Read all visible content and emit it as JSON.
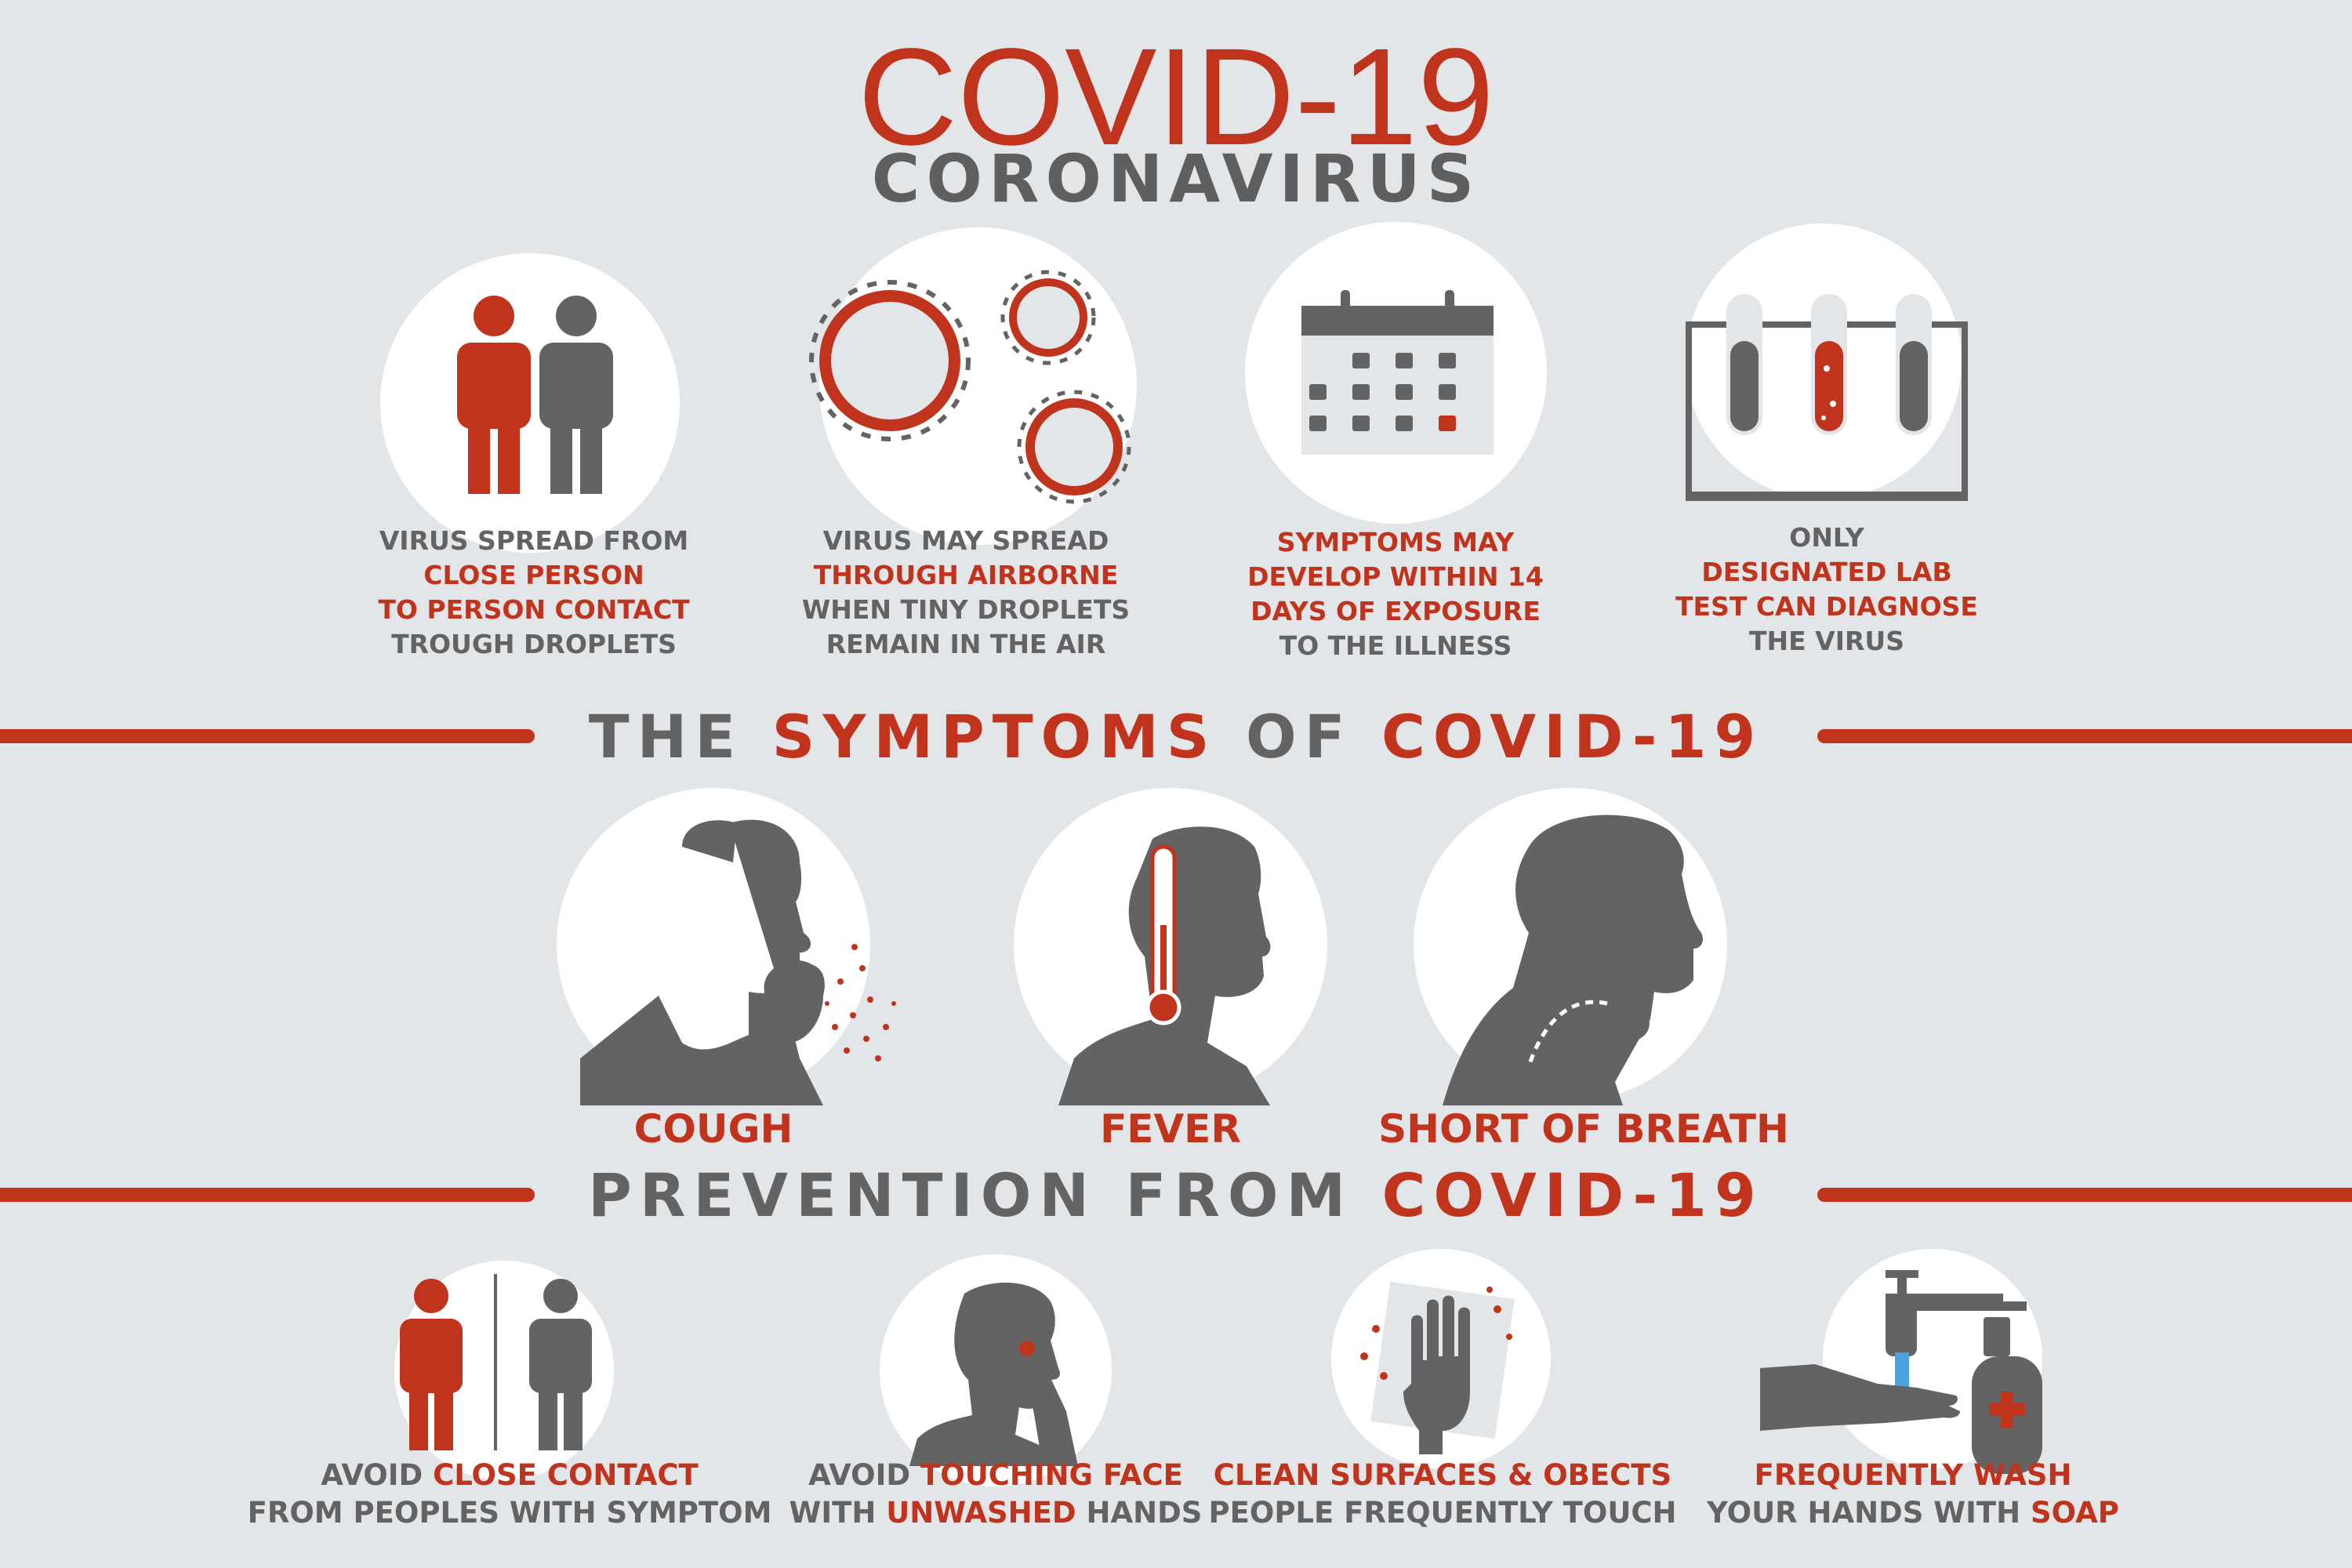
{
  "header": {
    "title": "COVID-19",
    "subtitle": "CORONAVIRUS"
  },
  "facts": [
    {
      "icon": "two-people-icon",
      "lines": [
        {
          "text": "VIRUS SPREAD FROM",
          "color": "gray"
        },
        {
          "text": "CLOSE PERSON",
          "color": "red"
        },
        {
          "text": "TO PERSON CONTACT",
          "color": "red"
        },
        {
          "text": "TROUGH DROPLETS",
          "color": "gray"
        }
      ]
    },
    {
      "icon": "virus-droplets-icon",
      "lines": [
        {
          "text": "VIRUS MAY SPREAD",
          "color": "gray"
        },
        {
          "text": "THROUGH AIRBORNE",
          "color": "red"
        },
        {
          "text": "WHEN TINY DROPLETS",
          "color": "gray"
        },
        {
          "text": "REMAIN IN THE AIR",
          "color": "gray"
        }
      ]
    },
    {
      "icon": "calendar-icon",
      "lines": [
        {
          "text": "SYMPTOMS MAY",
          "color": "red"
        },
        {
          "text": "DEVELOP WITHIN 14",
          "color": "red"
        },
        {
          "text": "DAYS OF EXPOSURE",
          "color": "red"
        },
        {
          "text": "TO THE ILLNESS",
          "color": "gray"
        }
      ]
    },
    {
      "icon": "test-tubes-icon",
      "lines": [
        {
          "text": "ONLY",
          "color": "gray"
        },
        {
          "text": "DESIGNATED LAB",
          "color": "red"
        },
        {
          "text": "TEST CAN DIAGNOSE",
          "color": "red"
        },
        {
          "text": "THE VIRUS",
          "color": "gray"
        }
      ]
    }
  ],
  "symptoms_heading": {
    "part1": "THE ",
    "part2": "SYMPTOMS",
    "part3": " OF ",
    "part4": "COVID-19"
  },
  "symptoms": [
    {
      "label": "COUGH",
      "icon": "coughing-person-icon"
    },
    {
      "label": "FEVER",
      "icon": "fever-thermometer-icon"
    },
    {
      "label": "SHORT OF BREATH",
      "icon": "breathing-person-icon"
    }
  ],
  "prevention_heading": {
    "part1": "PREVENTION FROM ",
    "part2": "COVID-19"
  },
  "prevention": [
    {
      "icon": "distance-people-icon",
      "line1": [
        {
          "text": "AVOID ",
          "color": "gray"
        },
        {
          "text": "CLOSE CONTACT",
          "color": "red"
        }
      ],
      "line2": [
        {
          "text": "FROM PEOPLES WITH SYMPTOM",
          "color": "gray"
        }
      ]
    },
    {
      "icon": "touching-face-icon",
      "line1": [
        {
          "text": "AVOID ",
          "color": "gray"
        },
        {
          "text": "TOUCHING FACE",
          "color": "red"
        }
      ],
      "line2": [
        {
          "text": "WITH ",
          "color": "gray"
        },
        {
          "text": "UNWASHED",
          "color": "red"
        },
        {
          "text": " HANDS",
          "color": "gray"
        }
      ]
    },
    {
      "icon": "cleaning-hand-icon",
      "line1": [
        {
          "text": "CLEAN SURFACES & OBECTS",
          "color": "red"
        }
      ],
      "line2": [
        {
          "text": "PEOPLE FREQUENTLY TOUCH",
          "color": "gray"
        }
      ]
    },
    {
      "icon": "hand-washing-icon",
      "line1": [
        {
          "text": "FREQUENTLY WASH",
          "color": "red"
        }
      ],
      "line2": [
        {
          "text": "YOUR HANDS WITH ",
          "color": "gray"
        },
        {
          "text": "SOAP",
          "color": "red"
        }
      ]
    }
  ],
  "colors": {
    "accent": "#c0341d",
    "text_gray": "#636363",
    "background": "#e3e6e8",
    "circle": "#ffffff"
  }
}
